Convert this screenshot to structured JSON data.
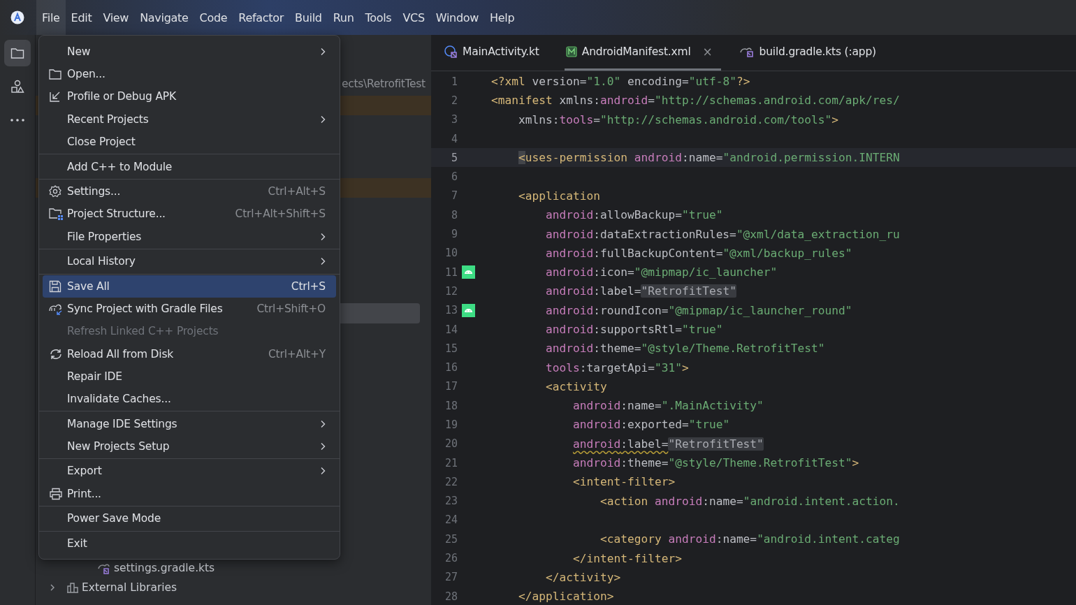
{
  "menubar": [
    {
      "label": "File",
      "selected": true
    },
    {
      "label": "Edit",
      "selected": false
    },
    {
      "label": "View",
      "selected": false
    },
    {
      "label": "Navigate",
      "selected": false
    },
    {
      "label": "Code",
      "selected": false
    },
    {
      "label": "Refactor",
      "selected": false
    },
    {
      "label": "Build",
      "selected": false
    },
    {
      "label": "Run",
      "selected": false
    },
    {
      "label": "Tools",
      "selected": false
    },
    {
      "label": "VCS",
      "selected": false
    },
    {
      "label": "Window",
      "selected": false
    },
    {
      "label": "Help",
      "selected": false
    }
  ],
  "tool_strip": [
    {
      "kind": "folder",
      "selected": true
    },
    {
      "kind": "shapes",
      "selected": false
    },
    {
      "kind": "more",
      "selected": false
    }
  ],
  "project_tree": {
    "path": "ects\\RetrofitTest",
    "items": [
      {
        "label": "settings.gradle.kts",
        "kind": "gradle",
        "expandable": false
      },
      {
        "label": "External Libraries",
        "kind": "library",
        "expandable": true
      }
    ]
  },
  "file_menu": [
    {
      "kind": "item",
      "label": "New",
      "submenu": true,
      "selected": false,
      "disabled": false
    },
    {
      "kind": "item",
      "label": "Open...",
      "selected": false,
      "disabled": false
    },
    {
      "kind": "item",
      "label": "Profile or Debug APK",
      "selected": false,
      "disabled": false
    },
    {
      "kind": "item",
      "label": "Recent Projects",
      "submenu": true,
      "selected": false,
      "disabled": false
    },
    {
      "kind": "item",
      "label": "Close Project",
      "selected": false,
      "disabled": false
    },
    {
      "kind": "separator"
    },
    {
      "kind": "item",
      "label": "Add C++ to Module",
      "selected": false,
      "disabled": false
    },
    {
      "kind": "separator"
    },
    {
      "kind": "item",
      "label": "Settings...",
      "shortcut": "Ctrl+Alt+S",
      "selected": false,
      "disabled": false
    },
    {
      "kind": "item",
      "label": "Project Structure...",
      "shortcut": "Ctrl+Alt+Shift+S",
      "selected": false,
      "disabled": false
    },
    {
      "kind": "item",
      "label": "File Properties",
      "submenu": true,
      "selected": false,
      "disabled": false
    },
    {
      "kind": "separator"
    },
    {
      "kind": "item",
      "label": "Local History",
      "submenu": true,
      "selected": false,
      "disabled": false
    },
    {
      "kind": "separator"
    },
    {
      "kind": "item",
      "label": "Save All",
      "shortcut": "Ctrl+S",
      "selected": true,
      "disabled": false
    },
    {
      "kind": "item",
      "label": "Sync Project with Gradle Files",
      "shortcut": "Ctrl+Shift+O",
      "selected": false,
      "disabled": false
    },
    {
      "kind": "item",
      "label": "Refresh Linked C++ Projects",
      "selected": false,
      "disabled": true
    },
    {
      "kind": "item",
      "label": "Reload All from Disk",
      "shortcut": "Ctrl+Alt+Y",
      "selected": false,
      "disabled": false
    },
    {
      "kind": "item",
      "label": "Repair IDE",
      "selected": false,
      "disabled": false
    },
    {
      "kind": "item",
      "label": "Invalidate Caches...",
      "selected": false,
      "disabled": false
    },
    {
      "kind": "separator"
    },
    {
      "kind": "item",
      "label": "Manage IDE Settings",
      "submenu": true,
      "selected": false,
      "disabled": false
    },
    {
      "kind": "item",
      "label": "New Projects Setup",
      "submenu": true,
      "selected": false,
      "disabled": false
    },
    {
      "kind": "separator"
    },
    {
      "kind": "item",
      "label": "Export",
      "submenu": true,
      "selected": false,
      "disabled": false
    },
    {
      "kind": "item",
      "label": "Print...",
      "selected": false,
      "disabled": false
    },
    {
      "kind": "separator"
    },
    {
      "kind": "item",
      "label": "Power Save Mode",
      "selected": false,
      "disabled": false
    },
    {
      "kind": "separator"
    },
    {
      "kind": "item",
      "label": "Exit",
      "selected": false,
      "disabled": false
    }
  ],
  "tabs": [
    {
      "label": "MainActivity.kt",
      "selected": false,
      "closable": false
    },
    {
      "label": "AndroidManifest.xml",
      "selected": true,
      "closable": true,
      "close": "×"
    },
    {
      "label": "build.gradle.kts (:app)",
      "selected": false,
      "closable": false
    }
  ],
  "editor": {
    "lines": [
      {
        "number": "1",
        "current": false,
        "gutter_icon": false,
        "tokens": [
          {
            "kind": "tag",
            "text": "<?xml"
          },
          {
            "kind": "plain",
            "text": " version="
          },
          {
            "kind": "string",
            "text": "\"1.0\""
          },
          {
            "kind": "plain",
            "text": " encoding="
          },
          {
            "kind": "string",
            "text": "\"utf-8\""
          },
          {
            "kind": "tag",
            "text": "?>"
          }
        ]
      },
      {
        "number": "2",
        "current": false,
        "gutter_icon": false,
        "tokens": [
          {
            "kind": "tag",
            "text": "<manifest"
          },
          {
            "kind": "plain",
            "text": " xmlns:"
          },
          {
            "kind": "ns",
            "text": "android"
          },
          {
            "kind": "plain",
            "text": "="
          },
          {
            "kind": "string",
            "text": "\"http://schemas.android.com/apk/res/"
          }
        ]
      },
      {
        "number": "3",
        "current": false,
        "gutter_icon": false,
        "tokens": [
          {
            "kind": "plain",
            "text": "    xmlns:"
          },
          {
            "kind": "ns",
            "text": "tools"
          },
          {
            "kind": "plain",
            "text": "="
          },
          {
            "kind": "string",
            "text": "\"http://schemas.android.com/tools\""
          },
          {
            "kind": "tag",
            "text": ">"
          }
        ]
      },
      {
        "number": "4",
        "current": false,
        "gutter_icon": false
      },
      {
        "number": "5",
        "current": true,
        "gutter_icon": false,
        "tokens": [
          {
            "kind": "tag",
            "text": "    <uses-permission"
          },
          {
            "kind": "ns",
            "text": " android"
          },
          {
            "kind": "plain",
            "text": ":name="
          },
          {
            "kind": "string",
            "text": "\"android.permission.INTERN"
          }
        ]
      },
      {
        "number": "6",
        "current": false,
        "gutter_icon": false
      },
      {
        "number": "7",
        "current": false,
        "gutter_icon": false,
        "tokens": [
          {
            "kind": "tag",
            "text": "    <application"
          }
        ]
      },
      {
        "number": "8",
        "current": false,
        "gutter_icon": false,
        "tokens": [
          {
            "kind": "ns",
            "text": "        android"
          },
          {
            "kind": "plain",
            "text": ":allowBackup="
          },
          {
            "kind": "string",
            "text": "\"true\""
          }
        ]
      },
      {
        "number": "9",
        "current": false,
        "gutter_icon": false,
        "tokens": [
          {
            "kind": "ns",
            "text": "        android"
          },
          {
            "kind": "plain",
            "text": ":dataExtractionRules="
          },
          {
            "kind": "string",
            "text": "\"@xml/data_extraction_ru"
          }
        ]
      },
      {
        "number": "10",
        "current": false,
        "gutter_icon": false,
        "tokens": [
          {
            "kind": "ns",
            "text": "        android"
          },
          {
            "kind": "plain",
            "text": ":fullBackupContent="
          },
          {
            "kind": "string",
            "text": "\"@xml/backup_rules\""
          }
        ]
      },
      {
        "number": "11",
        "current": false,
        "gutter_icon": true,
        "tokens": [
          {
            "kind": "ns",
            "text": "        android"
          },
          {
            "kind": "plain",
            "text": ":icon="
          },
          {
            "kind": "string",
            "text": "\"@mipmap/ic_launcher\""
          }
        ]
      },
      {
        "number": "12",
        "current": false,
        "gutter_icon": false,
        "tokens": [
          {
            "kind": "ns",
            "text": "        android"
          },
          {
            "kind": "plain",
            "text": ":label="
          },
          {
            "kind": "folded",
            "text": "\"RetrofitTest\""
          }
        ]
      },
      {
        "number": "13",
        "current": false,
        "gutter_icon": true,
        "tokens": [
          {
            "kind": "ns",
            "text": "        android"
          },
          {
            "kind": "plain",
            "text": ":roundIcon="
          },
          {
            "kind": "string",
            "text": "\"@mipmap/ic_launcher_round\""
          }
        ]
      },
      {
        "number": "14",
        "current": false,
        "gutter_icon": false,
        "tokens": [
          {
            "kind": "ns",
            "text": "        android"
          },
          {
            "kind": "plain",
            "text": ":supportsRtl="
          },
          {
            "kind": "string",
            "text": "\"true\""
          }
        ]
      },
      {
        "number": "15",
        "current": false,
        "gutter_icon": false,
        "tokens": [
          {
            "kind": "ns",
            "text": "        android"
          },
          {
            "kind": "plain",
            "text": ":theme="
          },
          {
            "kind": "string",
            "text": "\"@style/Theme.RetrofitTest\""
          }
        ]
      },
      {
        "number": "16",
        "current": false,
        "gutter_icon": false,
        "tokens": [
          {
            "kind": "ns",
            "text": "        tools"
          },
          {
            "kind": "plain",
            "text": ":targetApi="
          },
          {
            "kind": "string",
            "text": "\"31\""
          },
          {
            "kind": "tag",
            "text": ">"
          }
        ]
      },
      {
        "number": "17",
        "current": false,
        "gutter_icon": false,
        "tokens": [
          {
            "kind": "tag",
            "text": "        <activity"
          }
        ]
      },
      {
        "number": "18",
        "current": false,
        "gutter_icon": false,
        "tokens": [
          {
            "kind": "ns",
            "text": "            android"
          },
          {
            "kind": "plain",
            "text": ":name="
          },
          {
            "kind": "string",
            "text": "\".MainActivity\""
          }
        ]
      },
      {
        "number": "19",
        "current": false,
        "gutter_icon": false,
        "tokens": [
          {
            "kind": "ns",
            "text": "            android"
          },
          {
            "kind": "plain",
            "text": ":exported="
          },
          {
            "kind": "string",
            "text": "\"true\""
          }
        ]
      },
      {
        "number": "20",
        "current": false,
        "gutter_icon": false,
        "tokens": [
          {
            "kind": "ns",
            "text": "            android",
            "warning": true
          },
          {
            "kind": "plain",
            "text": ":label=",
            "warning": true
          },
          {
            "kind": "folded",
            "text": "\"RetrofitTest\""
          }
        ]
      },
      {
        "number": "21",
        "current": false,
        "gutter_icon": false,
        "tokens": [
          {
            "kind": "ns",
            "text": "            android"
          },
          {
            "kind": "plain",
            "text": ":theme="
          },
          {
            "kind": "string",
            "text": "\"@style/Theme.RetrofitTest\""
          },
          {
            "kind": "tag",
            "text": ">"
          }
        ]
      },
      {
        "number": "22",
        "current": false,
        "gutter_icon": false,
        "tokens": [
          {
            "kind": "tag",
            "text": "            <intent-filter>"
          }
        ]
      },
      {
        "number": "23",
        "current": false,
        "gutter_icon": false,
        "tokens": [
          {
            "kind": "tag",
            "text": "                <action"
          },
          {
            "kind": "ns",
            "text": " android"
          },
          {
            "kind": "plain",
            "text": ":name="
          },
          {
            "kind": "string",
            "text": "\"android.intent.action."
          }
        ]
      },
      {
        "number": "24",
        "current": false,
        "gutter_icon": false
      },
      {
        "number": "25",
        "current": false,
        "gutter_icon": false,
        "tokens": [
          {
            "kind": "tag",
            "text": "                <category"
          },
          {
            "kind": "ns",
            "text": " android"
          },
          {
            "kind": "plain",
            "text": ":name="
          },
          {
            "kind": "string",
            "text": "\"android.intent.categ"
          }
        ]
      },
      {
        "number": "26",
        "current": false,
        "gutter_icon": false,
        "tokens": [
          {
            "kind": "tag",
            "text": "            </intent-filter>"
          }
        ]
      },
      {
        "number": "27",
        "current": false,
        "gutter_icon": false,
        "tokens": [
          {
            "kind": "tag",
            "text": "        </activity>"
          }
        ]
      },
      {
        "number": "28",
        "current": false,
        "gutter_icon": false,
        "tokens": [
          {
            "kind": "tag",
            "text": "    </application>"
          }
        ]
      }
    ]
  }
}
